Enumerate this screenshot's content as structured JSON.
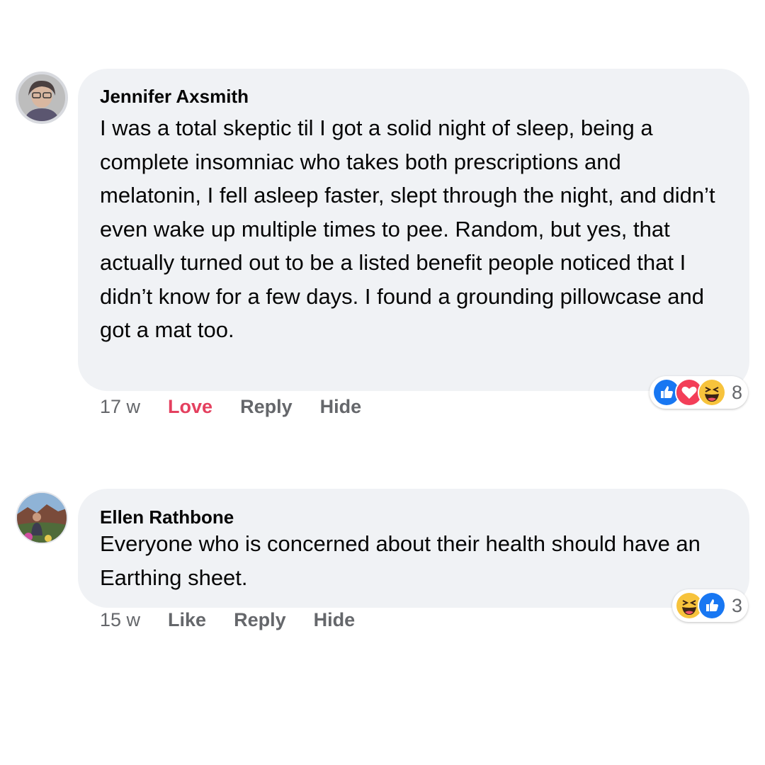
{
  "comments": [
    {
      "author": "Jennifer Axsmith",
      "text": "I was a total skeptic til I got a solid night of sleep, being a complete insomniac who takes both prescriptions and melatonin, I fell asleep faster, slept through the night, and didn’t even wake up multiple times to pee. Random, but yes, that actually turned out to be a listed benefit people noticed that I didn’t know for a few days. I found a grounding pillowcase and got a mat too.",
      "time": "17 w",
      "reaction_action": "Love",
      "reply_label": "Reply",
      "hide_label": "Hide",
      "reactions": [
        "like-icon",
        "love-icon",
        "haha-icon"
      ],
      "reaction_count": "8",
      "colors": {
        "love_action": "#e4405f"
      }
    },
    {
      "author": "Ellen Rathbone",
      "text": "Everyone who is concerned about their health should have an Earthing sheet.",
      "time": "15 w",
      "reaction_action": "Like",
      "reply_label": "Reply",
      "hide_label": "Hide",
      "reactions": [
        "haha-icon",
        "like-icon"
      ],
      "reaction_count": "3"
    }
  ]
}
